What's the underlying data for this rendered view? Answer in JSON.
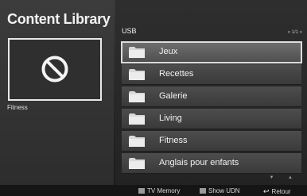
{
  "app": {
    "title": "Content Library"
  },
  "preview": {
    "icon": "no-content-icon",
    "label": "Fitness"
  },
  "browser": {
    "device": "USB",
    "pager": "« 1/1 »",
    "selected_index": 0,
    "items": [
      {
        "label": "Jeux",
        "icon": "folder-icon"
      },
      {
        "label": "Recettes",
        "icon": "folder-icon"
      },
      {
        "label": "Galerie",
        "icon": "folder-icon"
      },
      {
        "label": "Living",
        "icon": "folder-icon"
      },
      {
        "label": "Fitness",
        "icon": "folder-icon"
      },
      {
        "label": "Anglais pour enfants",
        "icon": "folder-icon"
      }
    ],
    "scroll_arrows": "▼ ▲"
  },
  "footer": {
    "tv_memory": "TV Memory",
    "show_udn": "Show UDN",
    "back": "Retour"
  },
  "colors": {
    "folder": "#d9d9d9",
    "selection_border": "#dcdcdc"
  }
}
